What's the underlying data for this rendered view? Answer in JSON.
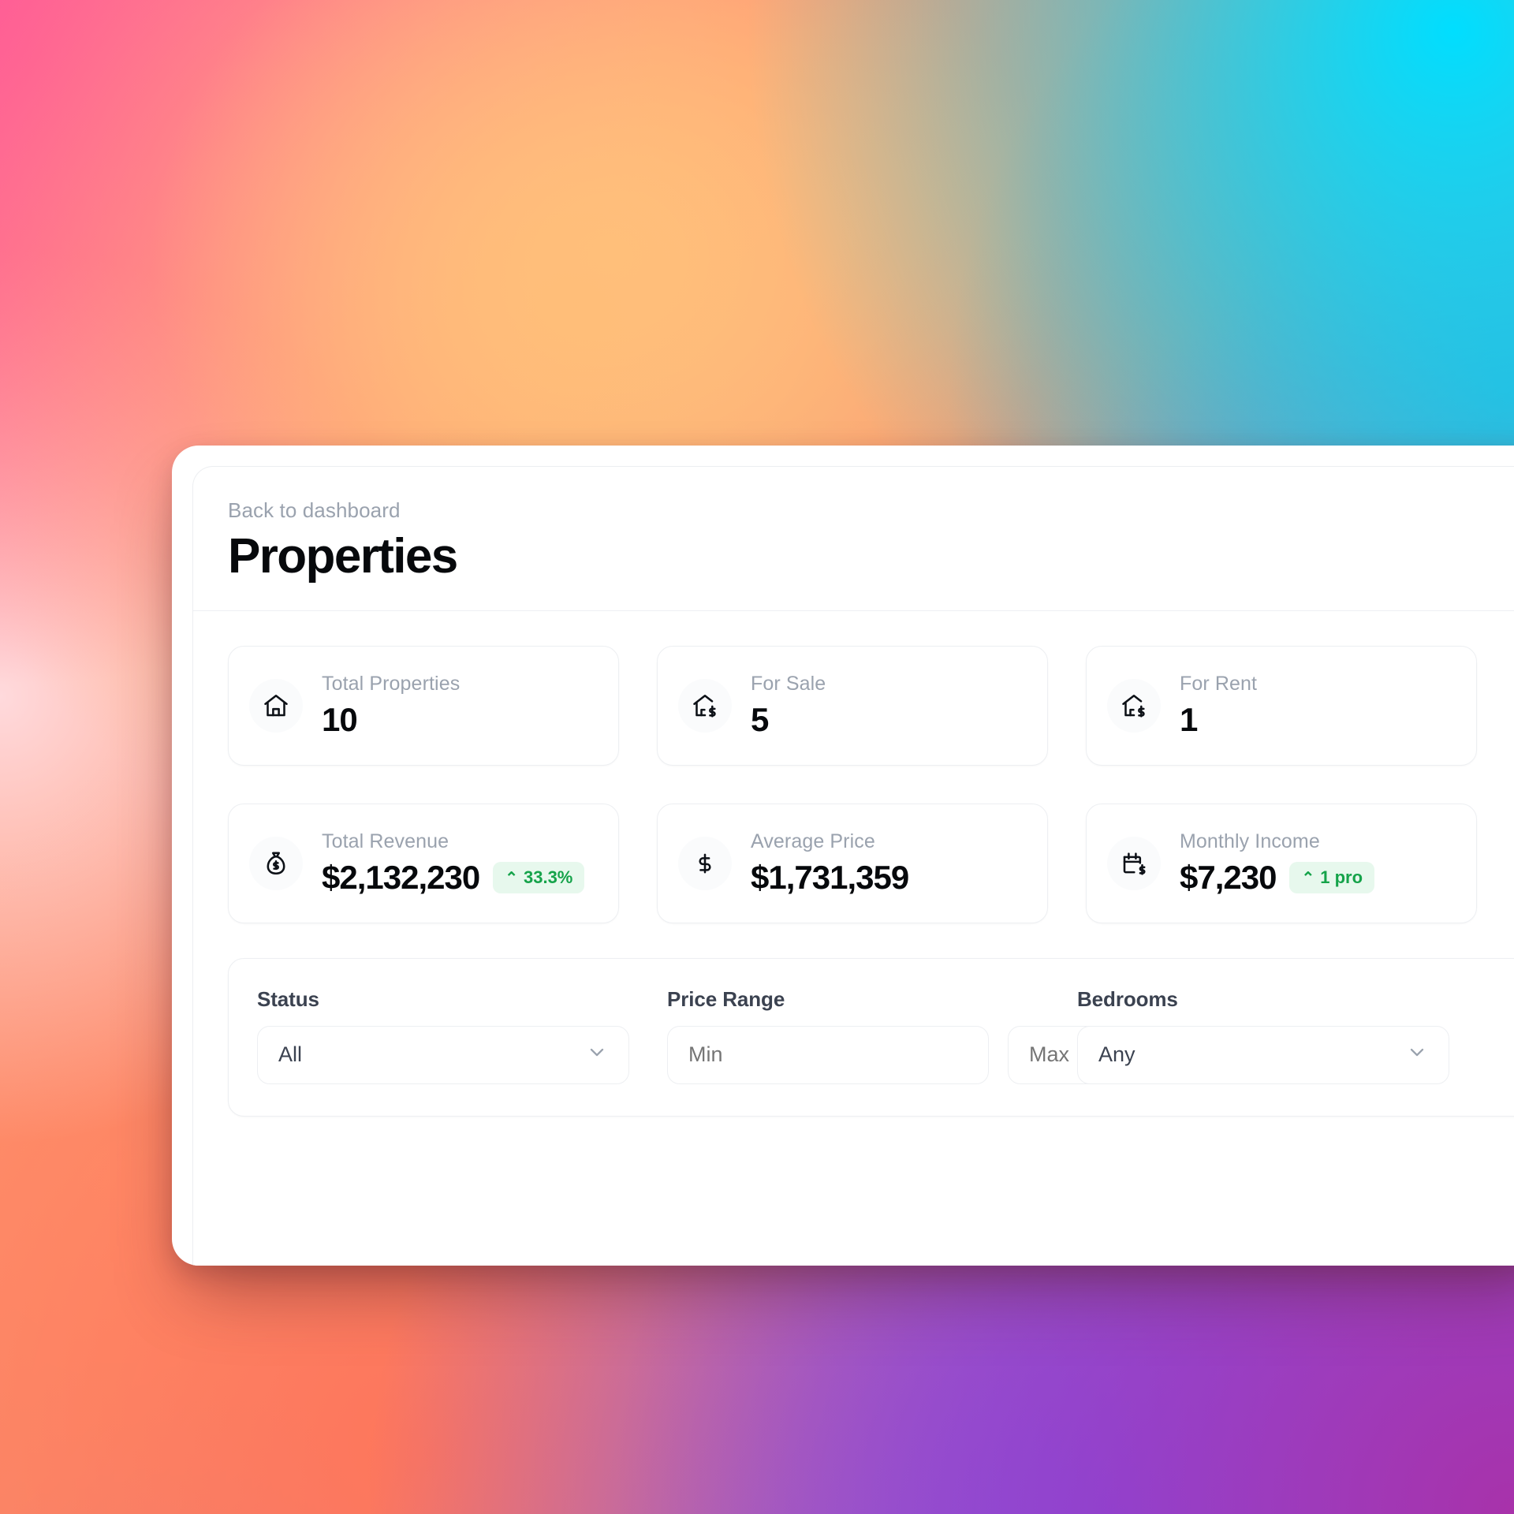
{
  "background": {
    "colors": [
      "#ff6a9c",
      "#ff8a6a",
      "#00deff",
      "#7a5cf5",
      "#a832aa",
      "#ffbe78"
    ]
  },
  "header": {
    "back_label": "Back to dashboard",
    "title": "Properties"
  },
  "stats": [
    {
      "icon": "home-icon",
      "label": "Total Properties",
      "value": "10",
      "badge": null
    },
    {
      "icon": "home-dollar-icon",
      "label": "For Sale",
      "value": "5",
      "badge": null
    },
    {
      "icon": "home-dollar-icon",
      "label": "For Rent",
      "value": "1",
      "badge": null
    },
    {
      "icon": "money-bag-icon",
      "label": "Total Revenue",
      "value": "$2,132,230",
      "badge": {
        "caret": "⌃",
        "text": "33.3%",
        "color": "#15a34a",
        "bg": "#e7f8ed"
      }
    },
    {
      "icon": "dollar-icon",
      "label": "Average Price",
      "value": "$1,731,359",
      "badge": null
    },
    {
      "icon": "calendar-dollar-icon",
      "label": "Monthly Income",
      "value": "$7,230",
      "badge": {
        "caret": "⌃",
        "text": "1 pro",
        "color": "#15a34a",
        "bg": "#e7f8ed"
      }
    }
  ],
  "filters": {
    "status": {
      "label": "Status",
      "value": "All"
    },
    "price_range": {
      "label": "Price Range",
      "min_placeholder": "Min",
      "max_placeholder": "Max",
      "min_value": "",
      "max_value": ""
    },
    "bedrooms": {
      "label": "Bedrooms",
      "value": "Any"
    }
  }
}
